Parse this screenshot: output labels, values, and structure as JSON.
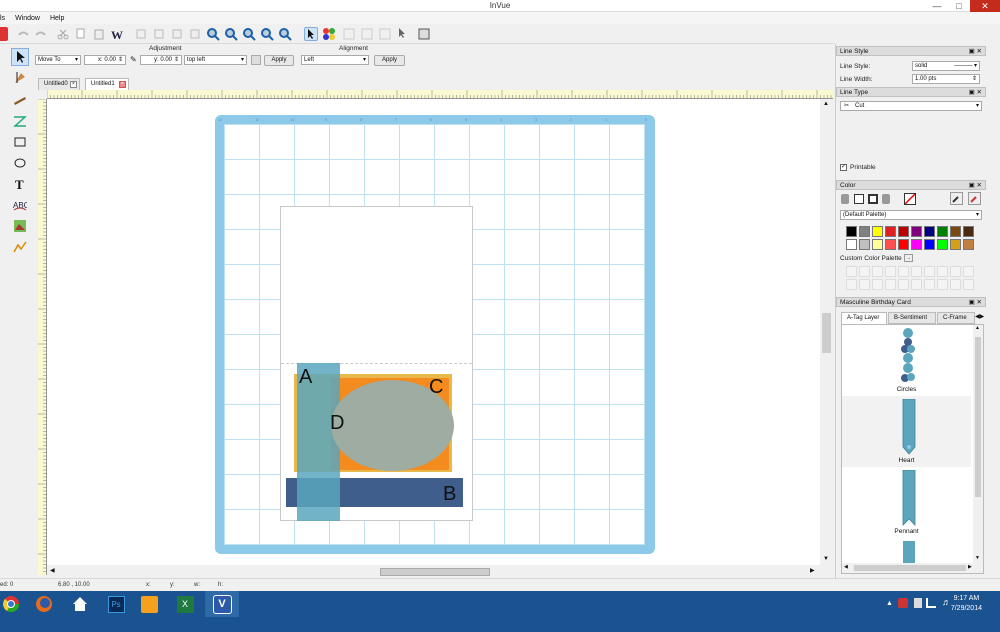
{
  "window": {
    "title": "InVue"
  },
  "menu": [
    "ls",
    "Window",
    "Help"
  ],
  "propbar": {
    "adjustment_label": "Adjustment",
    "alignment_label": "Alignment",
    "move_mode": "Move To",
    "x_field": "x: 0.00",
    "y_field": "y: 0.00",
    "anchor": "top left",
    "apply1": "Apply",
    "align_value": "Left",
    "apply2": "Apply"
  },
  "doc_tabs": [
    {
      "label": "Untitled0"
    },
    {
      "label": "Untitled1"
    }
  ],
  "canvas": {
    "shape_labels": {
      "a": "A",
      "b": "B",
      "c": "C",
      "d": "D"
    },
    "colors": {
      "mat": "#8dc9e8",
      "grid": "#bfe1f2",
      "rect_a": "#5ba6bd",
      "rect_b": "#3f5e8c",
      "rect_c_fill": "#f48b1e",
      "rect_c_border": "#e8b84a",
      "ellipse_d": "#9eaca1"
    }
  },
  "status": {
    "left": "ed: 0",
    "coords": "6.80 , 10.00",
    "x": "x:",
    "y": "y:",
    "w": "w:",
    "h": "h:"
  },
  "panels": {
    "line_style": {
      "title": "Line Style",
      "style_label": "Line Style:",
      "style_value": "solid",
      "width_label": "Line Width:",
      "width_value": "1.00 pts"
    },
    "line_type": {
      "title": "Line Type",
      "value": "Cut"
    },
    "printable_label": "Printable",
    "color": {
      "title": "Color",
      "palette": "(Default Palette)",
      "row1": [
        "#000000",
        "#808080",
        "#ffff00",
        "#e02020",
        "#c00000",
        "#800080",
        "#000080",
        "#008000",
        "#7a4a10",
        "#4a2a10"
      ],
      "row2": [
        "#ffffff",
        "#c0c0c0",
        "#ffff99",
        "#ff5050",
        "#ff0000",
        "#ff00ff",
        "#0000ff",
        "#00ff00",
        "#d4a017",
        "#c08040"
      ],
      "custom_label": "Custom Color Palette"
    },
    "layers": {
      "title": "Masculine Birthday Card",
      "tabs": [
        "A-Tag Layer",
        "B-Sentiment",
        "C-Frame"
      ],
      "items": [
        "Circles",
        "Heart",
        "Pennant"
      ]
    }
  },
  "taskbar": {
    "time": "9:17 AM",
    "date": "7/29/2014"
  }
}
